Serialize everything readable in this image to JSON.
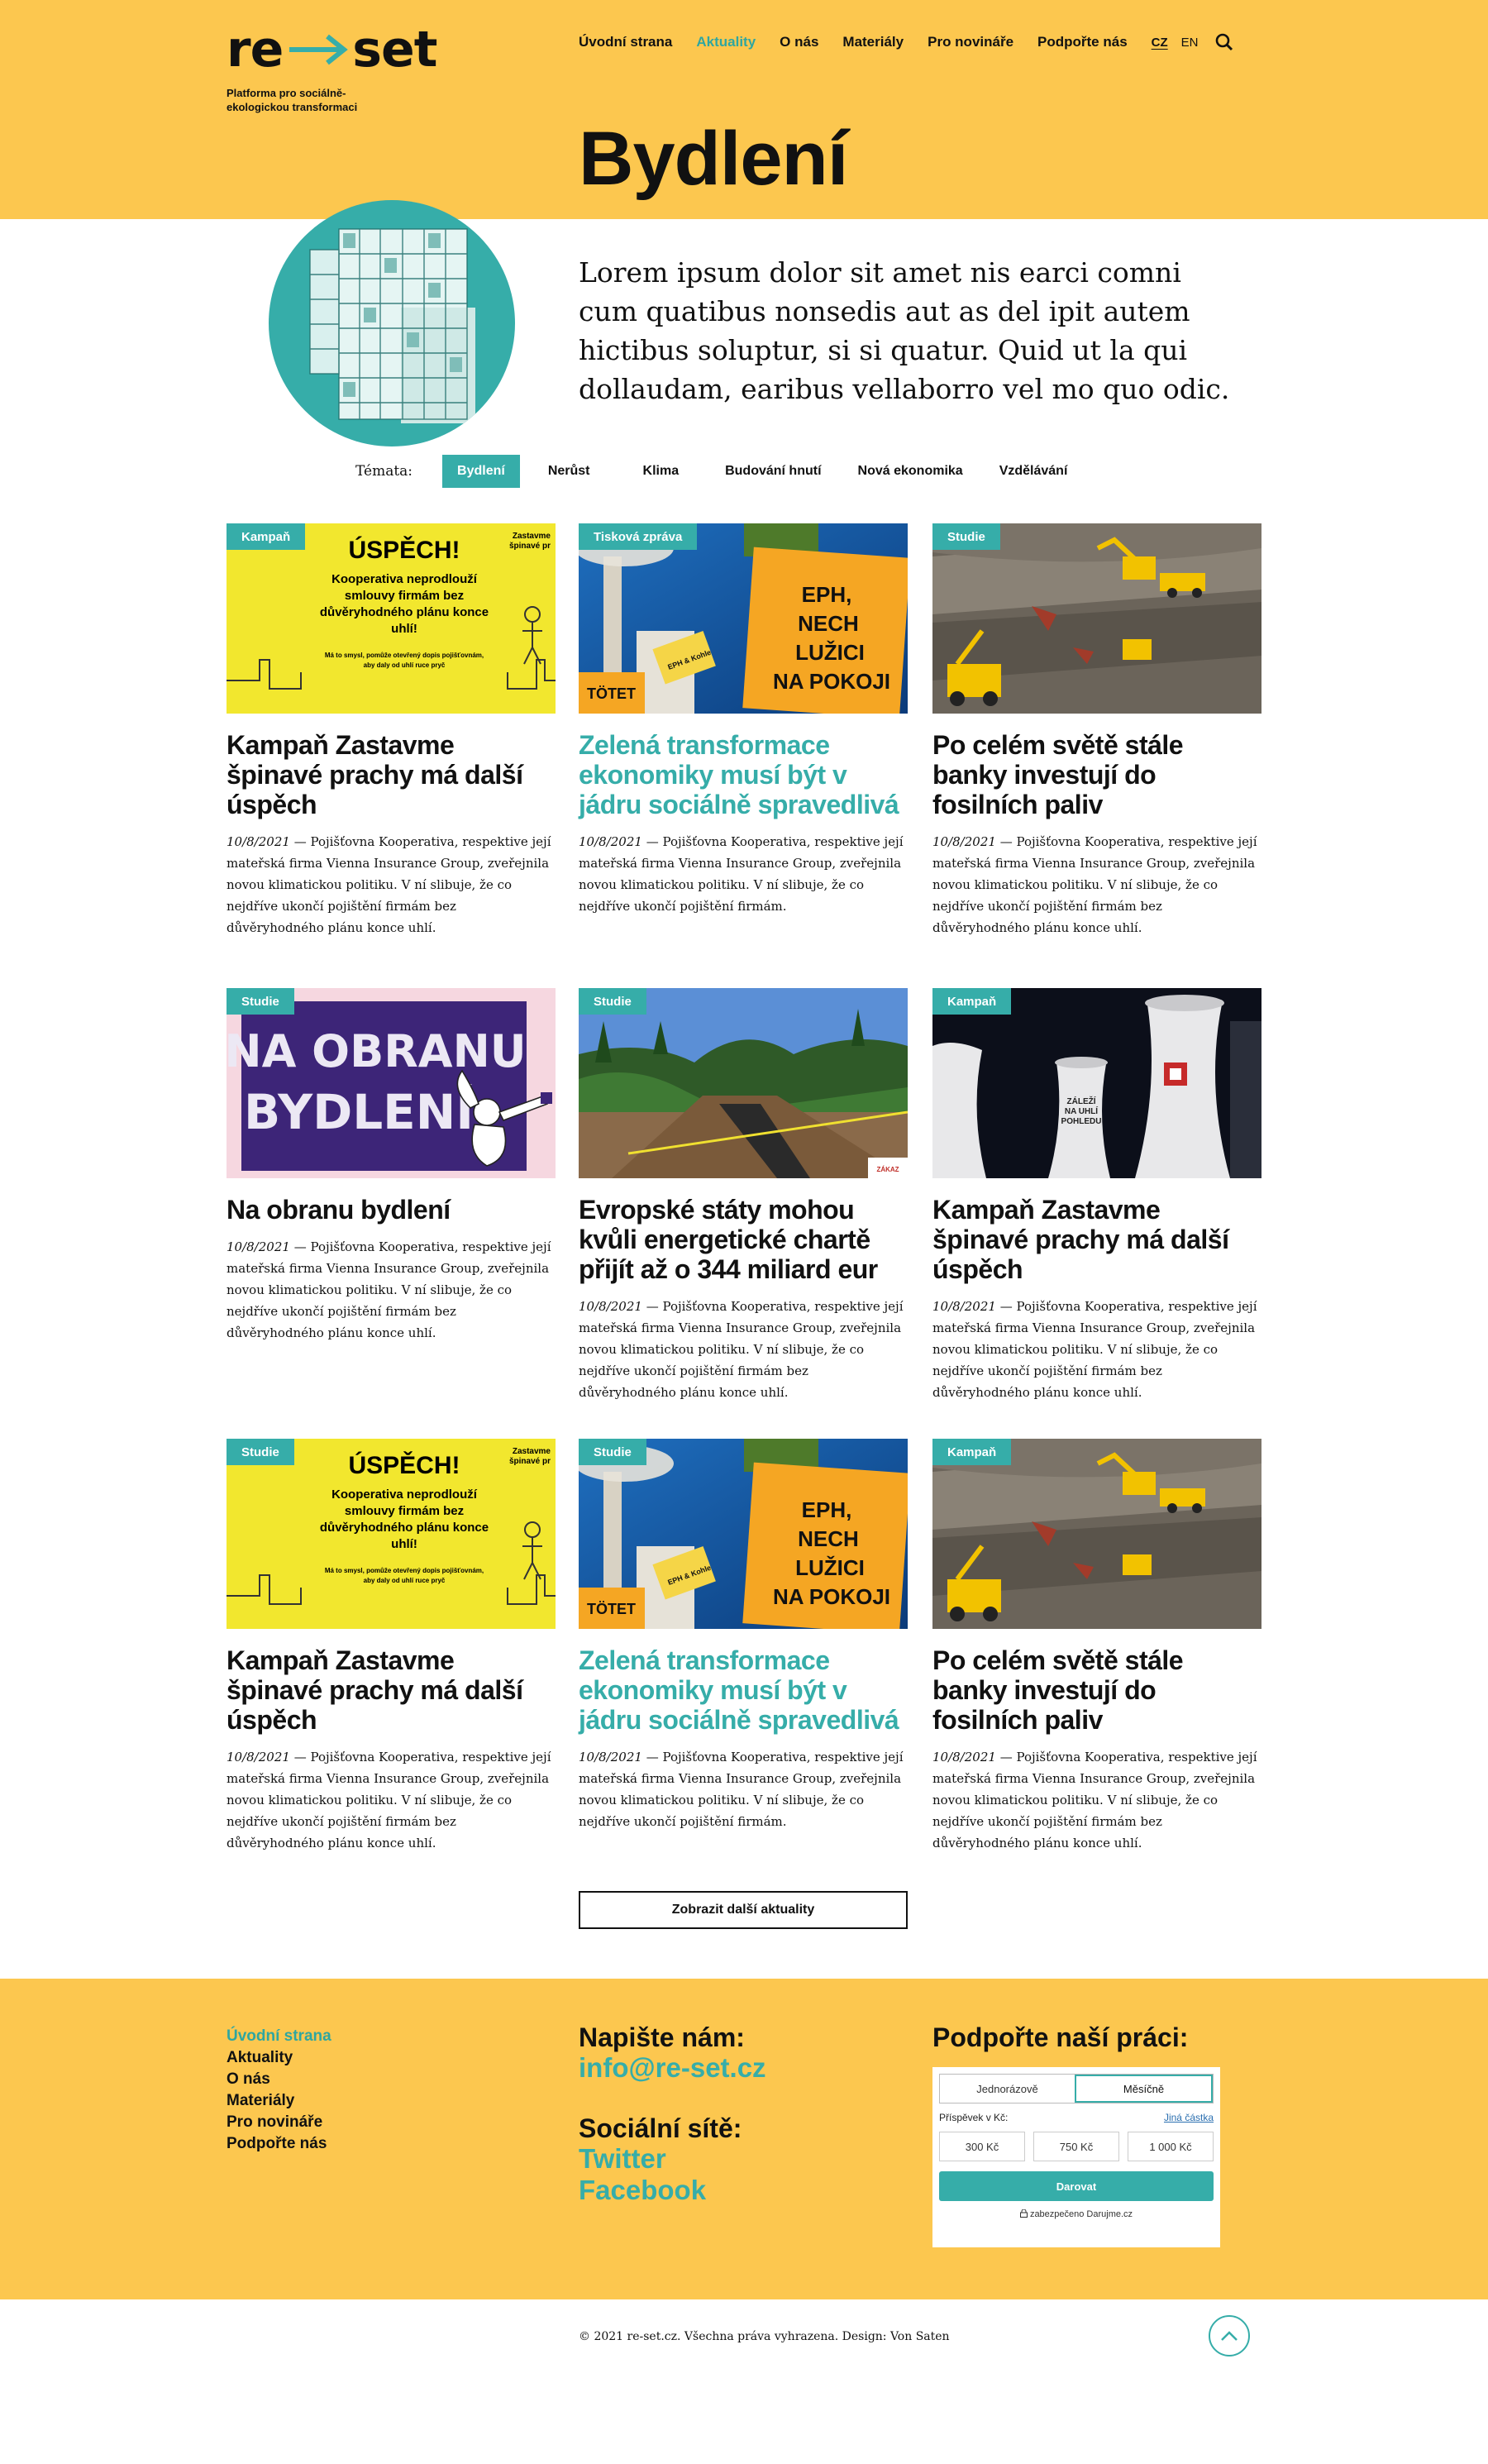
{
  "brand": {
    "tagline": "Platforma pro sociálně-ekologickou transformaci",
    "accent": "#36ADA9",
    "yellow": "#FCC74F"
  },
  "nav": {
    "items": [
      {
        "label": "Úvodní strana"
      },
      {
        "label": "Aktuality",
        "active": true
      },
      {
        "label": "O nás"
      },
      {
        "label": "Materiály"
      },
      {
        "label": "Pro novináře"
      },
      {
        "label": "Podpořte nás"
      }
    ],
    "lang_cz": "CZ",
    "lang_en": "EN"
  },
  "page": {
    "title": "Bydlení",
    "lead": "Lorem ipsum dolor sit amet nis earci comni cum quatibus nonsedis aut as del ipit autem hictibus soluptur, si si quatur. Quid ut la qui dollaudam, earibus vellaborro vel mo quo odic."
  },
  "filters": {
    "label": "Témata:",
    "items": [
      "Bydlení",
      "Nerůst",
      "Klima",
      "Budování hnutí",
      "Nová ekonomika",
      "Vzdělávání"
    ]
  },
  "cards": [
    {
      "badge": "Kampaň",
      "title": "Kampaň Zastavme špinavé prachy má další úspěch",
      "date": "10/8/2021",
      "excerpt": " — Pojišťovna Kooperativa, respektive její mateřská firma Vienna Insurance Group, zveřejnila novou klimatickou politiku. V ní slibuje, že co nejdříve ukončí pojištění firmám bez důvěryhodného plánu konce uhlí.",
      "image": "uspech-poster",
      "img_text": [
        "ÚSPĚCH!",
        "Kooperativa neprodlouží",
        "smlouvy firmám bez",
        "důvěryhodného plánu konce",
        "uhlí!",
        "Zastavme",
        "špinavé pr",
        "Má to smysl, pomůže otevřený dopis pojišťovnám,",
        "aby daly od uhlí ruce pryč"
      ]
    },
    {
      "badge": "Tisková zpráva",
      "title": "Zelená transformace ekonomiky musí být v jádru sociálně spravedlivá",
      "date": "10/8/2021",
      "excerpt": " — Pojišťovna Kooperativa, respektive její mateřská firma Vienna Insurance Group, zveřejnila novou klimatickou politiku. V ní slibuje, že co nejdříve ukončí pojištění firmám.",
      "image": "protest-sign",
      "teal": true,
      "img_text": [
        "EPH,",
        "NECH",
        "LUŽICI",
        "NA POKOJI",
        "TÖTET",
        "EPH & Kohle"
      ]
    },
    {
      "badge": "Studie",
      "title": "Po celém světě stále banky investují do fosilních paliv",
      "date": "10/8/2021",
      "excerpt": " — Pojišťovna Kooperativa, respektive její mateřská firma Vienna Insurance Group, zveřejnila novou klimatickou politiku. V ní slibuje, že co nejdříve ukončí pojištění firmám bez důvěryhodného plánu konce uhlí.",
      "image": "coal-mine"
    },
    {
      "badge": "Studie",
      "title": "Na obranu bydlení",
      "date": "10/8/2021",
      "excerpt": " — Pojišťovna Kooperativa, respektive její mateřská firma Vienna Insurance Group, zveřejnila novou klimatickou politiku. V ní slibuje, že co nejdříve ukončí pojištění firmám bez důvěryhodného plánu konce uhlí.",
      "image": "book-cover",
      "img_text": [
        "NA OBRANU",
        "BYDLENÍ"
      ]
    },
    {
      "badge": "Studie",
      "title": "Evropské státy mohou kvůli energetické chartě přijít až o 344 miliard eur",
      "date": "10/8/2021",
      "excerpt": " — Pojišťovna Kooperativa, respektive její mateřská firma Vienna Insurance Group, zveřejnila novou klimatickou politiku. V ní slibuje, že co nejdříve ukončí pojištění firmám bez důvěryhodného plánu konce uhlí.",
      "image": "pipeline",
      "img_text": [
        "ZÁKAZ"
      ]
    },
    {
      "badge": "Kampaň",
      "title": "Kampaň Zastavme špinavé prachy má další úspěch",
      "date": "10/8/2021",
      "excerpt": " — Pojišťovna Kooperativa, respektive její mateřská firma Vienna Insurance Group, zveřejnila novou klimatickou politiku. V ní slibuje, že co nejdříve ukončí pojištění firmám bez důvěryhodného plánu konce uhlí.",
      "image": "cooling-towers",
      "img_text": [
        "ZÁLEŽÍ",
        "NA UHLÍ",
        "POHLEDU"
      ]
    },
    {
      "badge": "Studie",
      "title": "Kampaň Zastavme špinavé prachy má další úspěch",
      "date": "10/8/2021",
      "excerpt": " — Pojišťovna Kooperativa, respektive její mateřská firma Vienna Insurance Group, zveřejnila novou klimatickou politiku. V ní slibuje, že co nejdříve ukončí pojištění firmám bez důvěryhodného plánu konce uhlí.",
      "image": "uspech-poster",
      "img_text": [
        "ÚSPĚCH!",
        "Kooperativa neprodlouží",
        "smlouvy firmám bez",
        "důvěryhodného plánu konce",
        "uhlí!",
        "Zastavme",
        "špinavé pr",
        "Má to smysl, pomůže otevřený dopis pojišťovnám,",
        "aby daly od uhlí ruce pryč"
      ]
    },
    {
      "badge": "Studie",
      "title": "Zelená transformace ekonomiky musí být v jádru sociálně spravedlivá",
      "date": "10/8/2021",
      "excerpt": " — Pojišťovna Kooperativa, respektive její mateřská firma Vienna Insurance Group, zveřejnila novou klimatickou politiku. V ní slibuje, že co nejdříve ukončí pojištění firmám.",
      "image": "protest-sign",
      "teal": true,
      "img_text": [
        "EPH,",
        "NECH",
        "LUŽICI",
        "NA POKOJI",
        "TÖTET",
        "EPH & Kohle"
      ]
    },
    {
      "badge": "Kampaň",
      "title": "Po celém světě stále banky investují do fosilních paliv",
      "date": "10/8/2021",
      "excerpt": " — Pojišťovna Kooperativa, respektive její mateřská firma Vienna Insurance Group, zveřejnila novou klimatickou politiku. V ní slibuje, že co nejdříve ukončí pojištění firmám bez důvěryhodného plánu konce uhlí.",
      "image": "coal-mine"
    }
  ],
  "more_button": "Zobrazit další aktuality",
  "footer": {
    "nav": [
      "Úvodní strana",
      "Aktuality",
      "O nás",
      "Materiály",
      "Pro novináře",
      "Podpořte nás"
    ],
    "write_heading": "Napište nám:",
    "email": "info@re-set.cz",
    "social_heading": "Sociální sítě:",
    "twitter": "Twitter",
    "facebook": "Facebook",
    "support_heading": "Podpořte naší práci:",
    "donate": {
      "tab_once": "Jednorázově",
      "tab_monthly": "Měsíčně",
      "contrib_label": "Příspěvek v Kč:",
      "other_amount": "Jiná částka",
      "amounts": [
        "300 Kč",
        "750 Kč",
        "1 000 Kč"
      ],
      "button": "Darovat",
      "secured": "zabezpečeno Darujme.cz"
    },
    "copyright": "© 2021 re-set.cz. Všechna práva vyhrazena. Design: Von Saten"
  }
}
